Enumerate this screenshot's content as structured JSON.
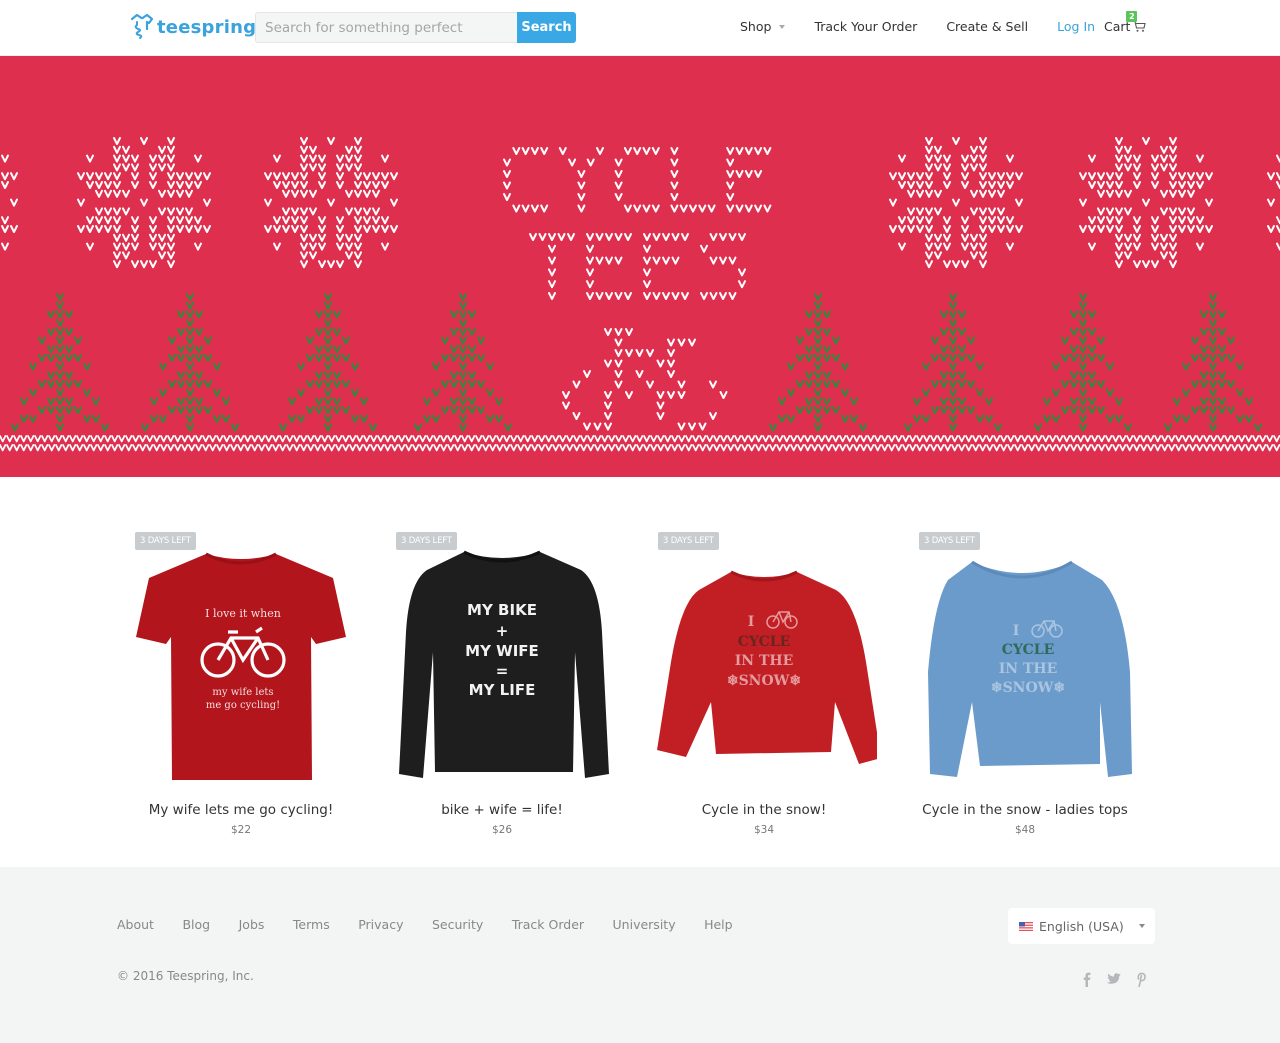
{
  "header": {
    "logo_text": "teespring",
    "search_placeholder": "Search for something perfect",
    "search_button": "Search",
    "nav": {
      "shop": "Shop",
      "track_order": "Track Your Order",
      "create_sell": "Create & Sell",
      "login": "Log In",
      "cart": "Cart",
      "cart_count": "2"
    }
  },
  "banner": {
    "title_line1": "CYCLE",
    "title_line2": "TEES",
    "colors": {
      "background": "#df2f4e",
      "stitch": "#ffffff",
      "tree": "#2e8b3c"
    }
  },
  "products": [
    {
      "badge": "3 DAYS LEFT",
      "title": "My wife lets me go cycling!",
      "price": "$22",
      "garment": "t-shirt",
      "color": "#b3151c",
      "print_lines": [
        "I love it when",
        "my wife lets",
        "me go cycling!"
      ]
    },
    {
      "badge": "3 DAYS LEFT",
      "title": "bike + wife = life!",
      "price": "$26",
      "garment": "long-sleeve",
      "color": "#1e1e1e",
      "print_lines": [
        "MY BIKE",
        "+",
        "MY WIFE",
        "=",
        "MY LIFE"
      ]
    },
    {
      "badge": "3 DAYS LEFT",
      "title": "Cycle in the snow!",
      "price": "$34",
      "garment": "sweatshirt",
      "color": "#c11f24",
      "print_lines": [
        "I",
        "CYCLE",
        "IN THE",
        "❄SNOW❄"
      ]
    },
    {
      "badge": "3 DAYS LEFT",
      "title": "Cycle in the snow - ladies tops",
      "price": "$48",
      "garment": "ladies-sweatshirt",
      "color": "#6b9bcb",
      "print_lines": [
        "I",
        "CYCLE",
        "IN THE",
        "❄SNOW❄"
      ]
    }
  ],
  "footer": {
    "links": [
      "About",
      "Blog",
      "Jobs",
      "Terms",
      "Privacy",
      "Security",
      "Track Order",
      "University",
      "Help"
    ],
    "copyright": "© 2016 Teespring, Inc.",
    "language": "English (USA)",
    "social": [
      "facebook-icon",
      "twitter-icon",
      "pinterest-icon"
    ]
  }
}
